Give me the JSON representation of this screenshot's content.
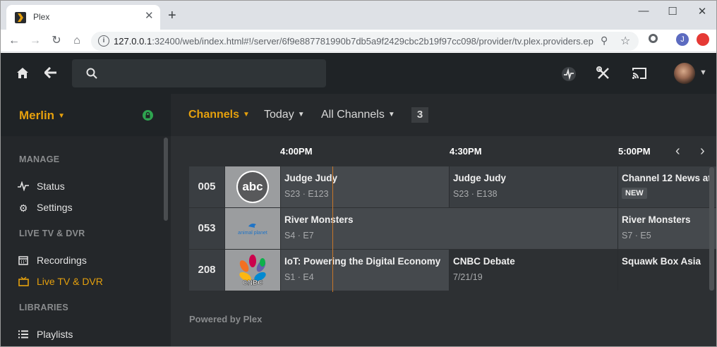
{
  "browser": {
    "tab_title": "Plex",
    "tab_close": "✕",
    "new_tab": "+",
    "url_host": "127.0.0.1",
    "url_rest": ":32400/web/index.html#!/server/6f9e887781990b7db5a9f2429cbc2b19f97cc098/provider/tv.plex.providers.ep...",
    "profile_initial": "J"
  },
  "plex": {
    "server_name": "Merlin",
    "search_placeholder": "",
    "sidebar": {
      "manage_header": "MANAGE",
      "status": "Status",
      "settings": "Settings",
      "livetv_header": "LIVE TV & DVR",
      "recordings": "Recordings",
      "livetv": "Live TV & DVR",
      "libraries_header": "LIBRARIES",
      "playlists": "Playlists"
    },
    "filters": {
      "channels": "Channels",
      "today": "Today",
      "all_channels": "All Channels",
      "count": "3"
    },
    "times": [
      "4:00PM",
      "4:30PM",
      "5:00PM"
    ],
    "channels": [
      {
        "number": "005",
        "logo": "abc",
        "programs": [
          {
            "title": "Judge Judy",
            "sub": "S23 · E123"
          },
          {
            "title": "Judge Judy",
            "sub": "S23 · E138"
          },
          {
            "title": "Channel 12 News at",
            "badge": "NEW"
          }
        ]
      },
      {
        "number": "053",
        "logo": "animal planet",
        "programs": [
          {
            "title": "River Monsters",
            "sub": "S4 · E7"
          },
          {
            "title": "River Monsters",
            "sub": "S7 · E5"
          }
        ]
      },
      {
        "number": "208",
        "logo": "CNBC",
        "programs": [
          {
            "title": "IoT: Powering the Digital Economy",
            "sub": "S1 · E4"
          },
          {
            "title": "CNBC Debate",
            "sub": "7/21/19"
          },
          {
            "title": "Squawk Box Asia",
            "sub": ""
          }
        ]
      }
    ],
    "powered_by": "Powered by Plex"
  }
}
